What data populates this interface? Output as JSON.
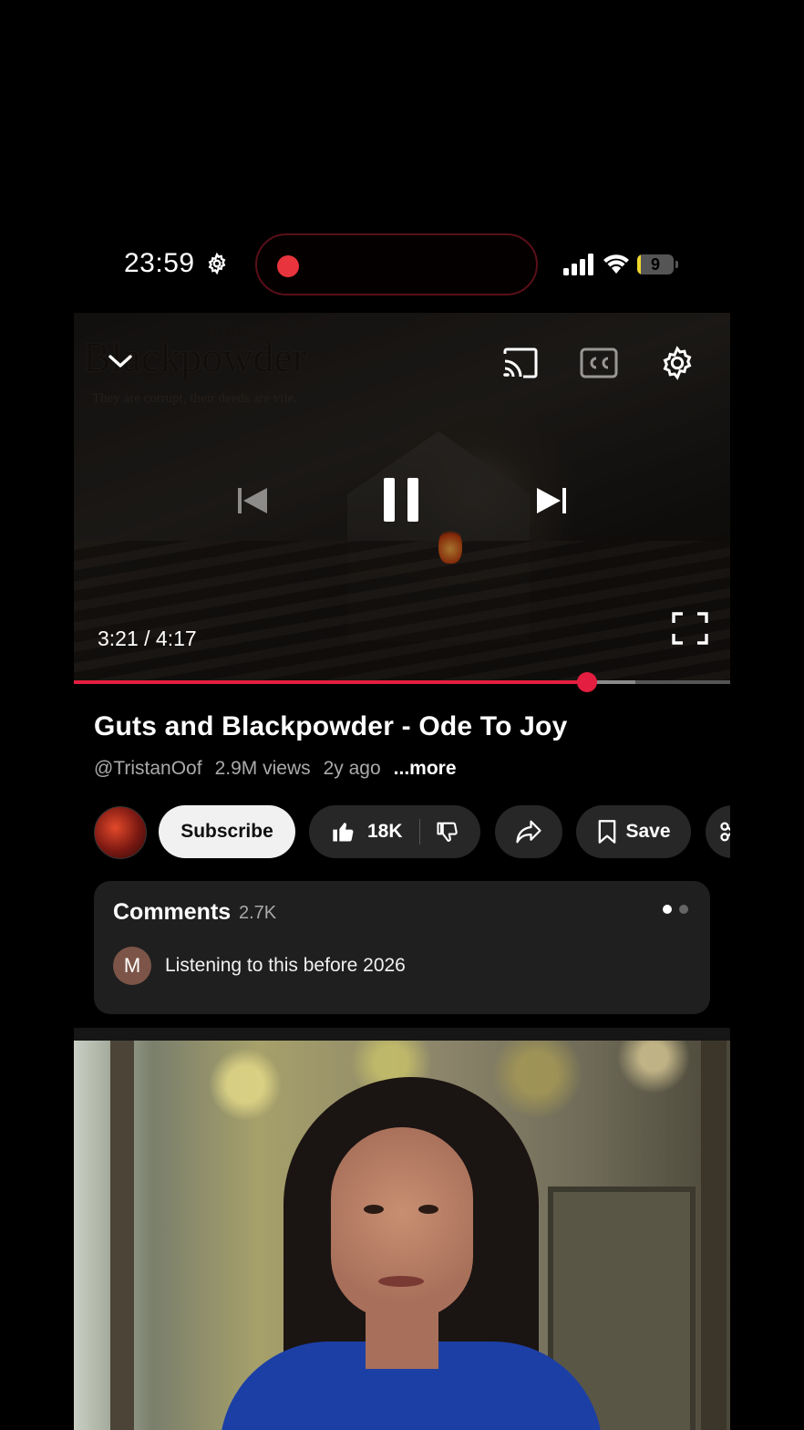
{
  "status_bar": {
    "time": "23:59",
    "battery_level": "9",
    "battery_fraction": 0.09,
    "icons": [
      "gear-icon",
      "record-dot-icon",
      "signal-icon",
      "wifi-icon",
      "battery-icon"
    ]
  },
  "player": {
    "watermark_title": "Blackpowder",
    "watermark_small": "Guts &",
    "watermark_tagline": "They are corrupt, their deeds are vile.",
    "time_display": "3:21 / 4:17",
    "progress_fraction": 0.782,
    "buffered_fraction": 0.856,
    "accent_color": "#e41e40",
    "icons": [
      "chevron-down-icon",
      "cast-icon",
      "cc-icon",
      "settings-icon",
      "skip-previous-icon",
      "pause-icon",
      "skip-next-icon",
      "fullscreen-icon"
    ]
  },
  "video": {
    "title": "Guts and Blackpowder - Ode To Joy",
    "channel": "@TristanOof",
    "views": "2.9M views",
    "age": "2y ago",
    "more_label": "...more"
  },
  "actions": {
    "subscribe_label": "Subscribe",
    "like_count": "18K",
    "save_label": "Save"
  },
  "comments": {
    "heading": "Comments",
    "count": "2.7K",
    "top_comment": {
      "avatar_letter": "M",
      "text": "Listening to this before 2026"
    }
  }
}
